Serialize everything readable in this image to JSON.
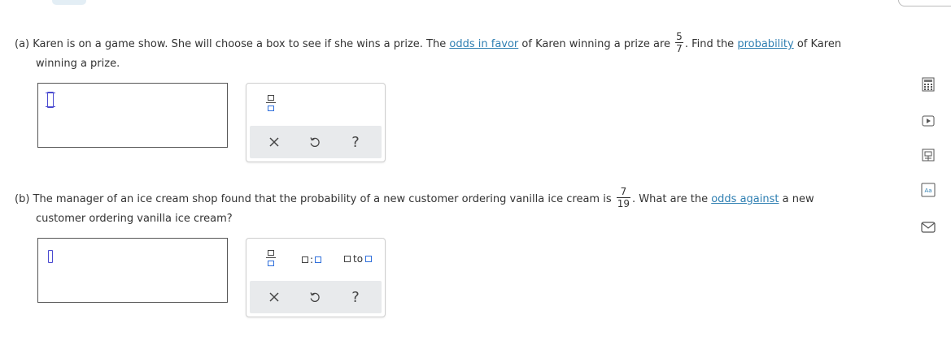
{
  "part_a": {
    "label": "(a)",
    "text1": "Karen is on a game show. She will choose a box to see if she wins a prize. The",
    "link1": "odds in favor",
    "text2": "of Karen winning a prize are",
    "fraction": {
      "numerator": "5",
      "denominator": "7"
    },
    "text3": ". Find the",
    "link2": "probability",
    "text4": "of Karen",
    "line2": "winning a prize."
  },
  "part_b": {
    "label": "(b)",
    "text1": "The manager of an ice cream shop found that the probability of a new customer ordering vanilla ice cream is",
    "fraction": {
      "numerator": "7",
      "denominator": "19"
    },
    "text2": ". What are the",
    "link1": "odds against",
    "text3": "a new",
    "line2": "customer ordering vanilla ice cream?"
  },
  "toolbar": {
    "clear_symbol": "×",
    "undo_symbol": "↺",
    "help_symbol": "?",
    "ratio_sep": ":",
    "to_word": "to"
  },
  "side_icons": [
    "calculator-icon",
    "video-icon",
    "reference-icon",
    "glossary-icon",
    "mail-icon"
  ],
  "glossary_label": "Aa"
}
